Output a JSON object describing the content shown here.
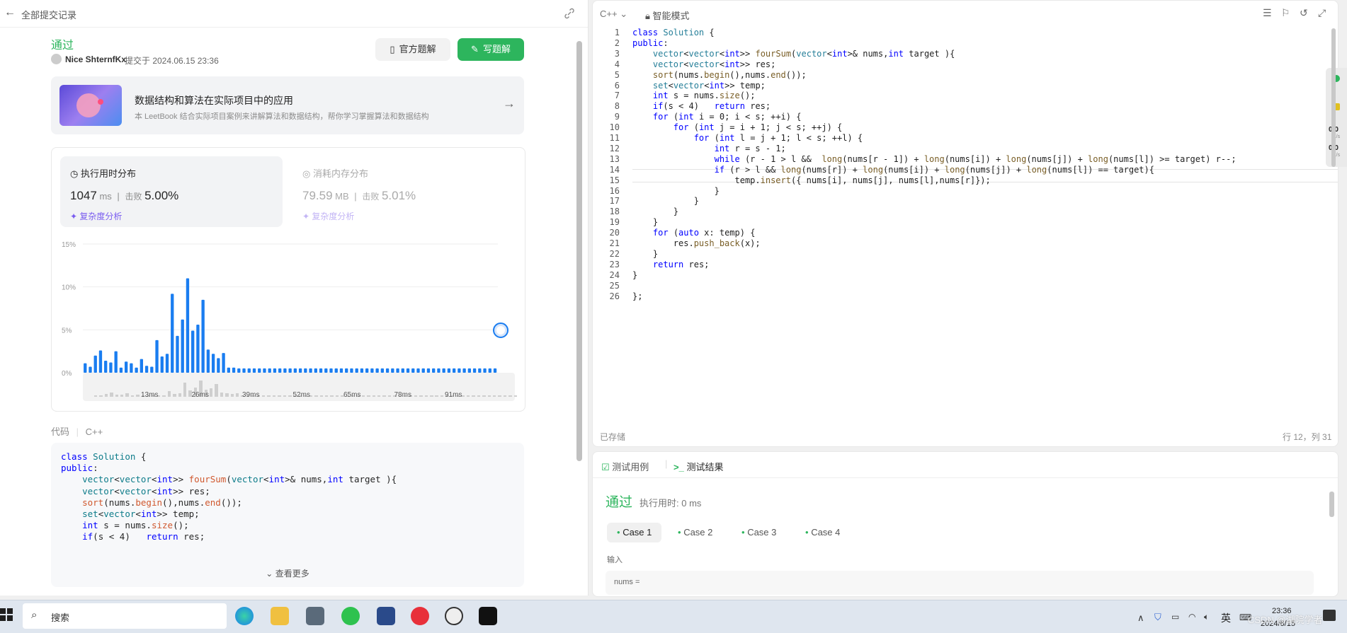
{
  "left": {
    "back_label": "全部提交记录",
    "status": "通过",
    "user": "Nice ShternfKx",
    "submitted_at": "提交于 2024.06.15 23:36",
    "btn_solution": "官方题解",
    "btn_write": "写题解",
    "banner_title": "数据结构和算法在实际项目中的应用",
    "banner_desc": "本 LeetBook 结合实际项目案例来讲解算法和数据结构，帮你学习掌握算法和数据结构",
    "runtime_label": "执行用时分布",
    "runtime_value": "1047",
    "runtime_unit": "ms",
    "beats_label": "击败",
    "runtime_beats": "5.00%",
    "complexity": "复杂度分析",
    "memory_label": "消耗内存分布",
    "memory_value": "79.59",
    "memory_unit": "MB",
    "memory_beats": "5.01%",
    "code_label": "代码",
    "lang": "C++",
    "see_more": "查看更多",
    "code_lines": [
      "class Solution {",
      "public:",
      "    vector<vector<int>> fourSum(vector<int>& nums,int target ){",
      "    vector<vector<int>> res;",
      "    sort(nums.begin(),nums.end());",
      "    set<vector<int>> temp;",
      "    int s = nums.size();",
      "    if(s < 4)   return res;"
    ]
  },
  "chart_data": {
    "type": "bar",
    "yticks": [
      "15%",
      "10%",
      "5%",
      "0%"
    ],
    "xticks": [
      "13ms",
      "26ms",
      "39ms",
      "52ms",
      "65ms",
      "78ms",
      "91ms"
    ],
    "ylim": [
      0,
      15
    ],
    "values": [
      1.1,
      0.7,
      2.0,
      2.6,
      1.4,
      1.2,
      2.5,
      0.6,
      1.3,
      1.1,
      0.6,
      1.6,
      0.8,
      0.7,
      3.8,
      1.9,
      2.2,
      9.2,
      4.3,
      6.2,
      11.0,
      4.9,
      5.6,
      8.5,
      2.7,
      2.2,
      1.7,
      2.3,
      0.6,
      0.6,
      0.5,
      0.5,
      0.5,
      0.5,
      0.5,
      0.5,
      0.5,
      0.5,
      0.5,
      0.5,
      0.5,
      0.5,
      0.5,
      0.5,
      0.5,
      0.5,
      0.5,
      0.5,
      0.5,
      0.5,
      0.5,
      0.5,
      0.5,
      0.5,
      0.5,
      0.5,
      0.5,
      0.5,
      0.5,
      0.5,
      0.5,
      0.5,
      0.5,
      0.5,
      0.5,
      0.5,
      0.5,
      0.5,
      0.5,
      0.5,
      0.5,
      0.5,
      0.5,
      0.5,
      0.5,
      0.5,
      0.5,
      0.5,
      0.5,
      0.5,
      0.5
    ],
    "color": "#1a7df0",
    "mini_xticks": [
      "13ms",
      "26ms",
      "39ms",
      "52ms",
      "65ms",
      "78ms",
      "91ms"
    ]
  },
  "editor": {
    "lang": "C++",
    "mode": "智能模式",
    "saved": "已存储",
    "cursor": "行 12，列 31",
    "lines": [
      "class Solution {",
      "public:",
      "    vector<vector<int>> fourSum(vector<int>& nums,int target ){",
      "    vector<vector<int>> res;",
      "    sort(nums.begin(),nums.end());",
      "    set<vector<int>> temp;",
      "    int s = nums.size();",
      "    if(s < 4)   return res;",
      "    for (int i = 0; i < s; ++i) {",
      "        for (int j = i + 1; j < s; ++j) {",
      "            for (int l = j + 1; l < s; ++l) {",
      "                int r = s - 1;",
      "                while (r - 1 > l &&  long(nums[r - 1]) + long(nums[i]) + long(nums[j]) + long(nums[l]) >= target) r--;",
      "                if (r > l && long(nums[r]) + long(nums[i]) + long(nums[j]) + long(nums[l]) == target){",
      "                    temp.insert({ nums[i], nums[j], nums[l],nums[r]});",
      "                }",
      "            }",
      "        }",
      "    }",
      "    for (auto x: temp) {",
      "        res.push_back(x);",
      "    }",
      "    return res;",
      "}",
      "",
      "};"
    ]
  },
  "test": {
    "tab_cases": "测试用例",
    "tab_result": "测试结果",
    "status": "通过",
    "runtime": "执行用时: 0 ms",
    "cases": [
      "Case 1",
      "Case 2",
      "Case 3",
      "Case 4"
    ],
    "input_label": "输入",
    "input_value": "nums ="
  },
  "side_stats": [
    "0.0",
    "K/s",
    "0.0",
    "K/s"
  ],
  "taskbar": {
    "search": "搜索",
    "ime": "英",
    "time": "23:36",
    "date": "2024/6/15",
    "watermark": "CSDN @湖院学者"
  }
}
